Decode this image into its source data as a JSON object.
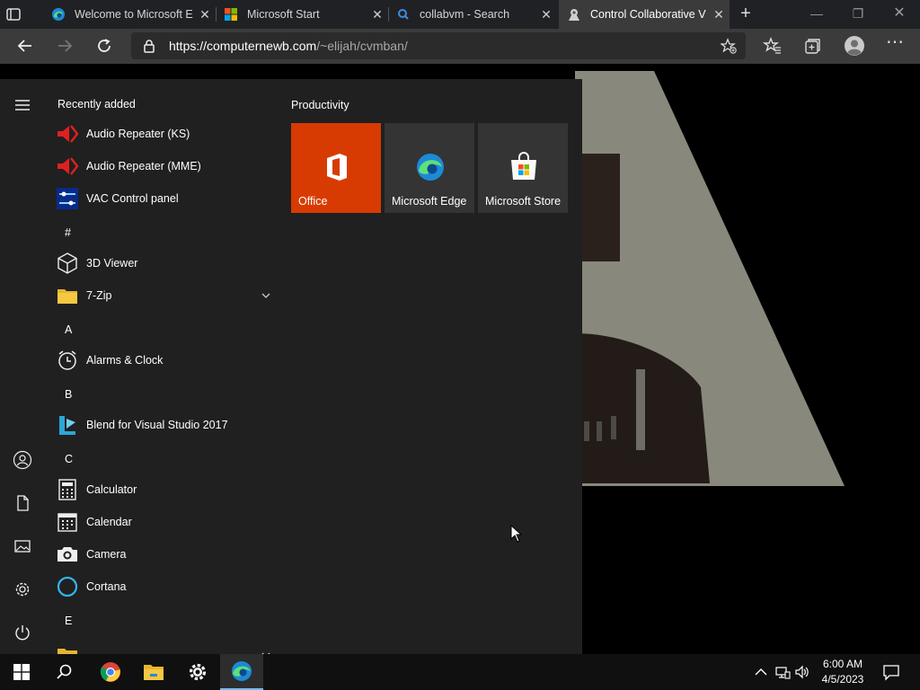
{
  "browser": {
    "tabs": [
      {
        "title": "Welcome to Microsoft E",
        "icon": "edge-icon",
        "active": false
      },
      {
        "title": "Microsoft Start",
        "icon": "microsoft-logo-icon",
        "active": false
      },
      {
        "title": "collabvm - Search",
        "icon": "search-icon",
        "active": false
      },
      {
        "title": "Control Collaborative V",
        "icon": "collabvm-icon",
        "active": true
      }
    ],
    "url_host": "https://computernewb.com",
    "url_path": "/~elijah/cvmban/"
  },
  "start_menu": {
    "recently_added_label": "Recently added",
    "recent_apps": [
      {
        "label": "Audio Repeater (KS)",
        "icon": "audio-repeater-icon"
      },
      {
        "label": "Audio Repeater (MME)",
        "icon": "audio-repeater-icon"
      },
      {
        "label": "VAC Control panel",
        "icon": "vac-control-icon"
      }
    ],
    "groups": [
      {
        "letter": "#",
        "apps": [
          {
            "label": "3D Viewer",
            "icon": "3d-viewer-icon"
          },
          {
            "label": "7-Zip",
            "icon": "folder-icon",
            "expandable": true
          }
        ]
      },
      {
        "letter": "A",
        "apps": [
          {
            "label": "Alarms & Clock",
            "icon": "alarm-clock-icon"
          }
        ]
      },
      {
        "letter": "B",
        "apps": [
          {
            "label": "Blend for Visual Studio 2017",
            "icon": "blend-icon"
          }
        ]
      },
      {
        "letter": "C",
        "apps": [
          {
            "label": "Calculator",
            "icon": "calculator-icon"
          },
          {
            "label": "Calendar",
            "icon": "calendar-icon"
          },
          {
            "label": "Camera",
            "icon": "camera-icon"
          },
          {
            "label": "Cortana",
            "icon": "cortana-icon"
          }
        ]
      },
      {
        "letter": "E",
        "apps": []
      }
    ],
    "tiles_group_label": "Productivity",
    "tiles": [
      {
        "label": "Office",
        "icon": "office-icon",
        "color": "#d83b01"
      },
      {
        "label": "Microsoft Edge",
        "icon": "edge-icon",
        "color": "#343434"
      },
      {
        "label": "Microsoft Store",
        "icon": "store-icon",
        "color": "#343434"
      }
    ]
  },
  "taskbar": {
    "time": "6:00 AM",
    "date": "4/5/2023",
    "accent": "#76b9ed"
  }
}
